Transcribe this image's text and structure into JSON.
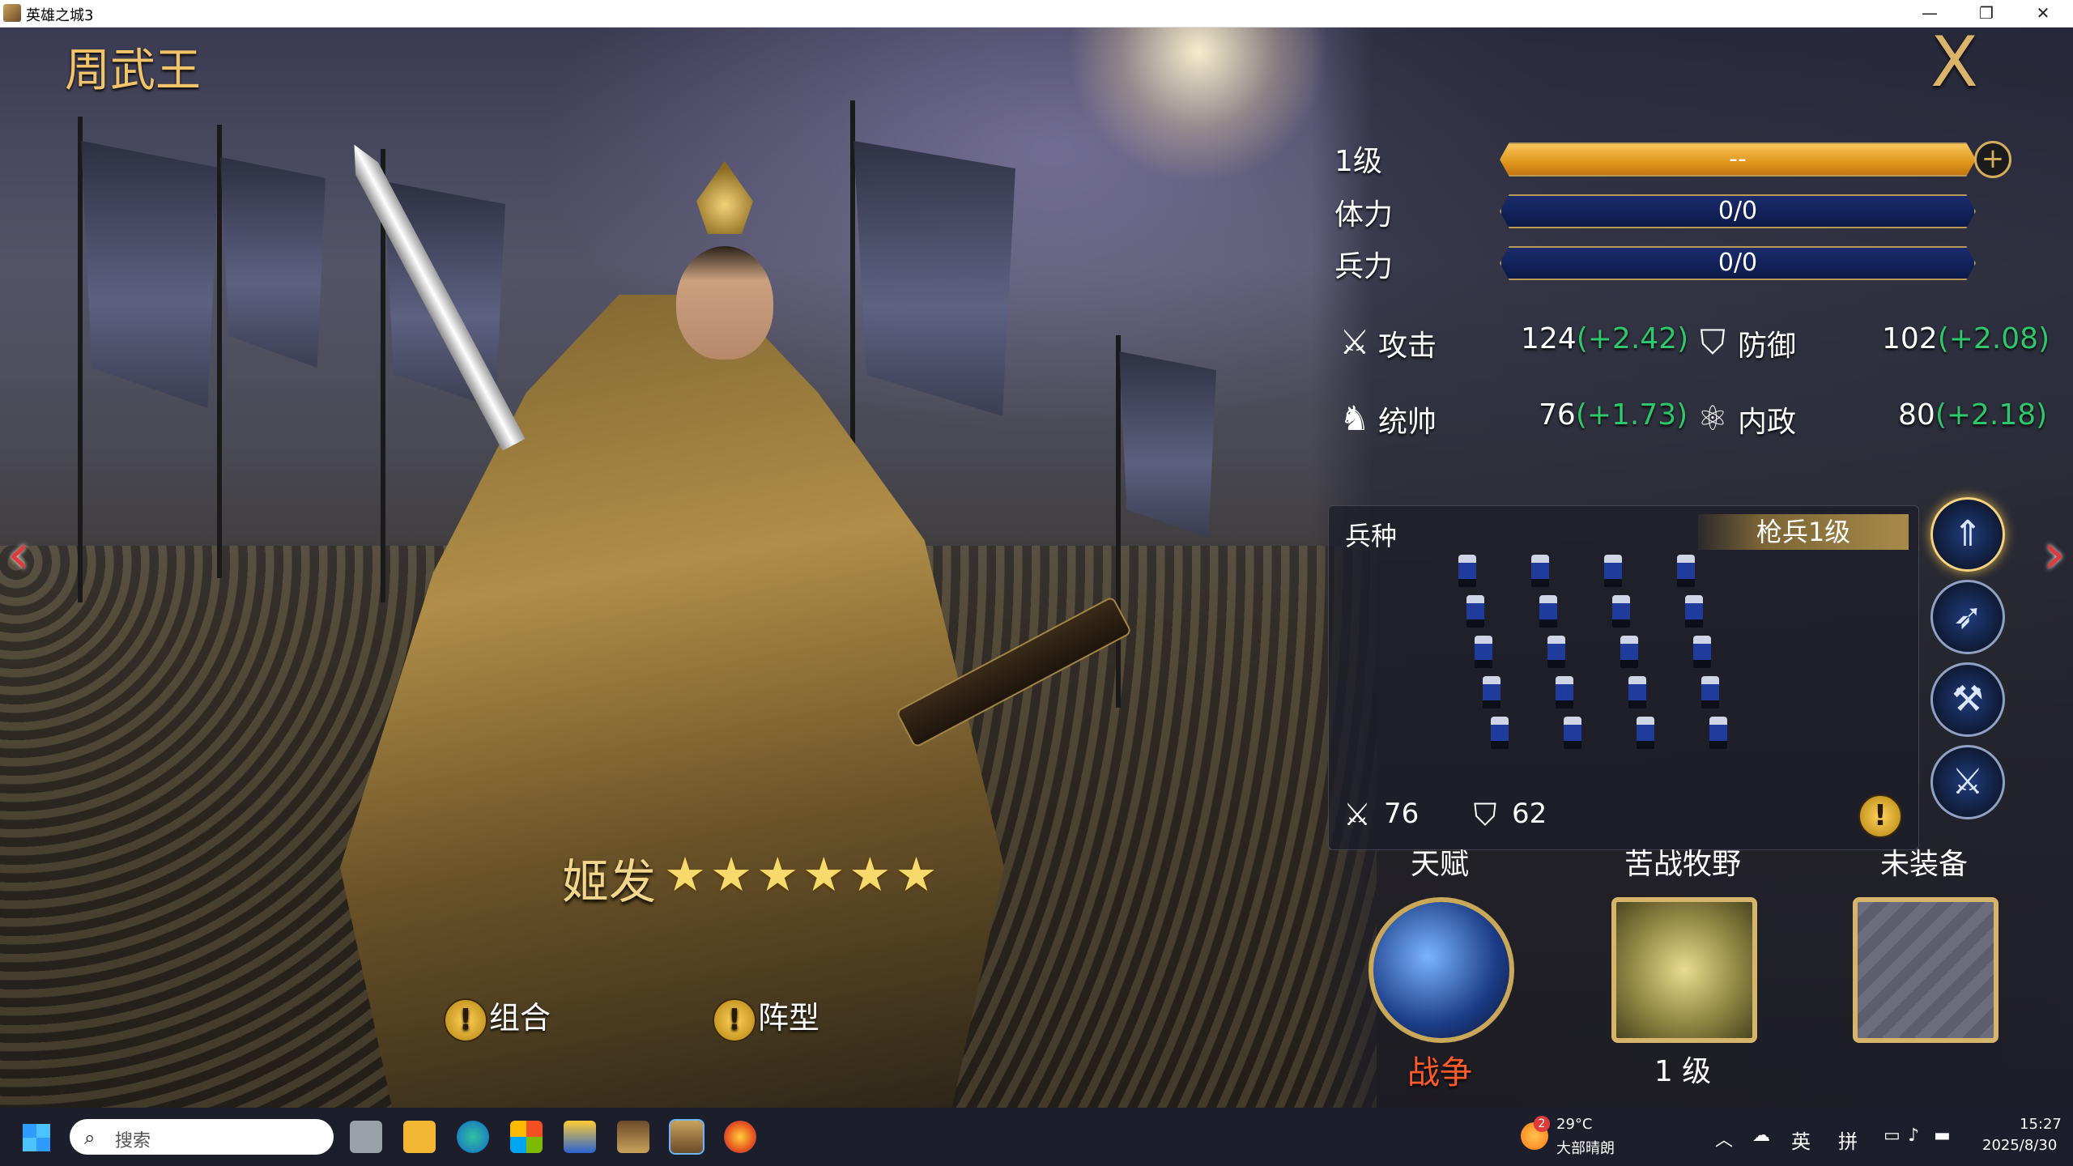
{
  "window": {
    "title": "英雄之城3",
    "minimize": "—",
    "maximize": "❐",
    "close": "✕"
  },
  "hero": {
    "title": "周武王",
    "name": "姬发",
    "stars": 6,
    "star_glyph": "★"
  },
  "close_label": "X",
  "stats": {
    "level_label": "1级",
    "level_value": "--",
    "stamina_label": "体力",
    "stamina_value": "0/0",
    "troops_label": "兵力",
    "troops_value": "0/0"
  },
  "attributes": [
    {
      "label": "攻击",
      "value": "124",
      "bonus": "(+2.42)",
      "icon": "swords-icon"
    },
    {
      "label": "防御",
      "value": "102",
      "bonus": "(+2.08)",
      "icon": "shield-icon"
    },
    {
      "label": "统帅",
      "value": "76",
      "bonus": "(+1.73)",
      "icon": "helmet-icon"
    },
    {
      "label": "内政",
      "value": "80",
      "bonus": "(+2.18)",
      "icon": "atom-icon"
    }
  ],
  "troop": {
    "title": "兵种",
    "badge": "枪兵1级",
    "attack": "76",
    "defense": "62",
    "types": [
      "spear-icon",
      "bow-icon",
      "hammer-icon",
      "axe-icon"
    ]
  },
  "slots": [
    {
      "label": "天赋",
      "sub": "战争",
      "kind": "talent"
    },
    {
      "label": "苦战牧野",
      "sub": "1 级",
      "kind": "skill"
    },
    {
      "label": "未装备",
      "sub": "",
      "kind": "empty"
    }
  ],
  "buttons": {
    "combo": "组合",
    "formation": "阵型",
    "warn_glyph": "!"
  },
  "nav": {
    "left": "‹",
    "right": "›"
  },
  "taskbar": {
    "search_placeholder": "搜索",
    "weather_badge": "2",
    "temperature": "29°C",
    "weather": "大部晴朗",
    "ime_lang": "英",
    "ime_mode": "拼",
    "time": "15:27",
    "date": "2025/8/30"
  },
  "colors": {
    "gold": "#f2c46a",
    "bonus_green": "#2fc76b",
    "talent_red": "#ff5a2a",
    "bar_gold": "#e0951c",
    "bar_blue": "#0b1a48"
  }
}
